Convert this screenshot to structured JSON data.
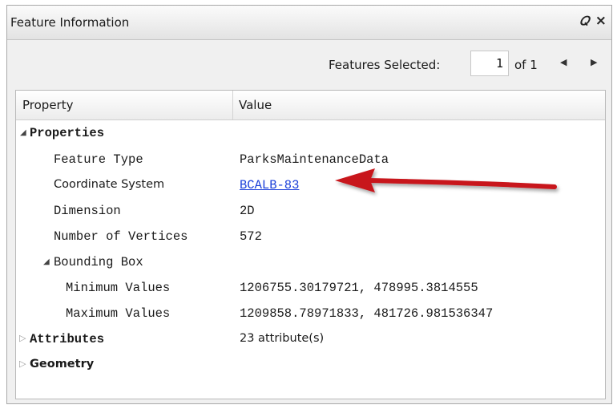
{
  "panel": {
    "title": "Feature Information",
    "float_icon": "float-window-icon",
    "close_icon": "close-icon"
  },
  "toolbar": {
    "features_selected_label": "Features Selected:",
    "current_value": "1",
    "of_label": "of 1",
    "prev_icon": "triangle-left-icon",
    "next_icon": "triangle-right-icon"
  },
  "grid": {
    "columns": [
      "Property",
      "Value"
    ],
    "properties_group": {
      "label": "Properties",
      "feature_type": {
        "name": "Feature Type",
        "value": "ParksMaintenanceData"
      },
      "coordinate_system": {
        "name": "Coordinate System",
        "value": "BCALB-83"
      },
      "dimension": {
        "name": "Dimension",
        "value": "2D"
      },
      "vertices": {
        "name": "Number of Vertices",
        "value": "572"
      },
      "bounding_box": {
        "label": "Bounding Box",
        "minimum": {
          "name": "Minimum Values",
          "value": "1206755.30179721, 478995.3814555"
        },
        "maximum": {
          "name": "Maximum Values",
          "value": "1209858.78971833, 481726.981536347"
        }
      }
    },
    "attributes": {
      "label": "Attributes",
      "value": "23 attribute(s)"
    },
    "geometry": {
      "label": "Geometry"
    }
  },
  "colors": {
    "annotation_arrow": "#c8151b",
    "link": "#1a3fd9"
  }
}
